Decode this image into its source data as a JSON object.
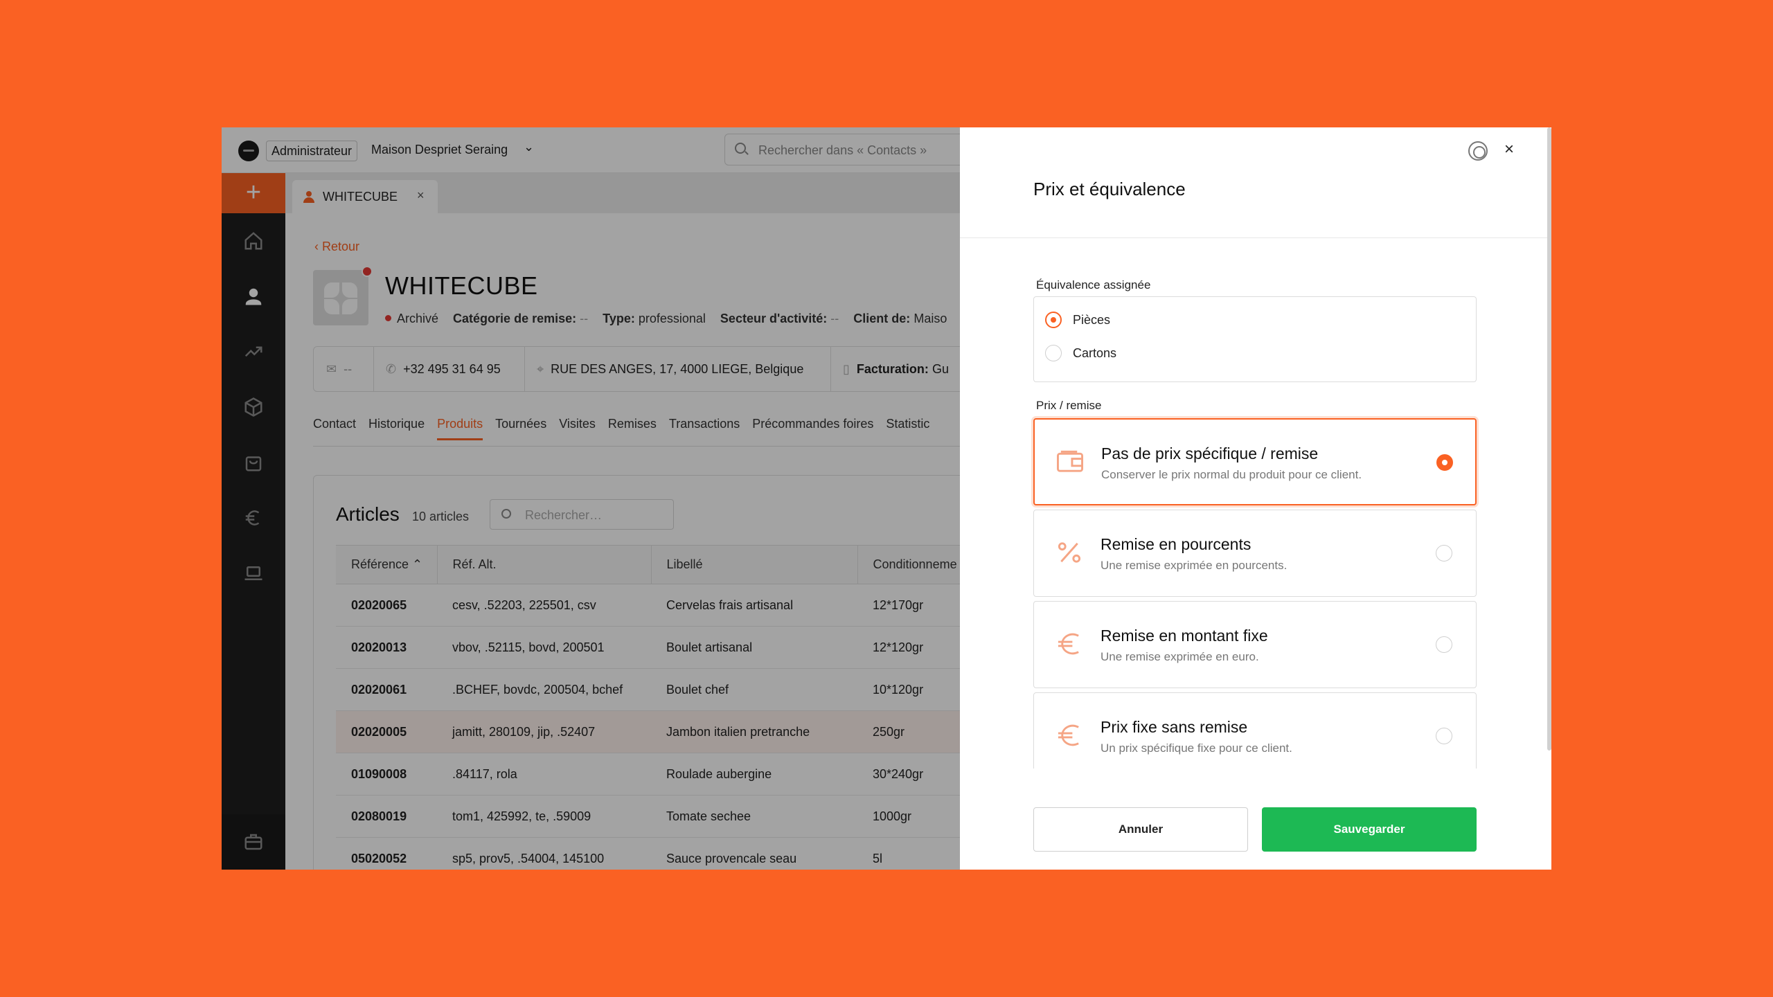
{
  "topbar": {
    "role": "Administrateur",
    "shop": "Maison Despriet Seraing",
    "search_placeholder": "Rechercher dans « Contacts »"
  },
  "tab": {
    "label": "WHITECUBE",
    "close": "×"
  },
  "client": {
    "back": "Retour",
    "name": "WHITECUBE",
    "status": "Archivé",
    "meta": {
      "categorie_label": "Catégorie de remise:",
      "categorie_value": "--",
      "type_label": "Type:",
      "type_value": "professional",
      "secteur_label": "Secteur d'activité:",
      "secteur_value": "--",
      "client_de_label": "Client de:",
      "client_de_value": "Maiso"
    },
    "contact": {
      "email": "--",
      "phone": "+32 495 31 64 95",
      "address": "RUE DES ANGES, 17, 4000 LIEGE, Belgique",
      "billing_label": "Facturation:",
      "billing_value": "Gu"
    },
    "tabs": [
      "Contact",
      "Historique",
      "Produits",
      "Tournées",
      "Visites",
      "Remises",
      "Transactions",
      "Précommandes foires",
      "Statistic"
    ],
    "active_tab": "Produits"
  },
  "articles": {
    "title": "Articles",
    "count": "10 articles",
    "search_placeholder": "Rechercher…",
    "columns": [
      "Référence ⌃",
      "Réf. Alt.",
      "Libellé",
      "Conditionneme"
    ],
    "rows": [
      [
        "02020065",
        "cesv, .52203, 225501, csv",
        "Cervelas frais artisanal",
        "12*170gr"
      ],
      [
        "02020013",
        "vbov, .52115, bovd, 200501",
        "Boulet artisanal",
        "12*120gr"
      ],
      [
        "02020061",
        ".BCHEF, bovdc, 200504, bchef",
        "Boulet chef",
        "10*120gr"
      ],
      [
        "02020005",
        "jamitt, 280109, jip, .52407",
        "Jambon italien pretranche",
        "250gr"
      ],
      [
        "01090008",
        ".84117, rola",
        "Roulade aubergine",
        "30*240gr"
      ],
      [
        "02080019",
        "tom1, 425992, te, .59009",
        "Tomate sechee",
        "1000gr"
      ],
      [
        "05020052",
        "sp5, prov5, .54004, 145100",
        "Sauce provencale seau",
        "5l"
      ]
    ]
  },
  "modal": {
    "title": "Prix et équivalence",
    "equivalence_label": "Équivalence assignée",
    "equivalence_options": [
      "Pièces",
      "Cartons"
    ],
    "price_label": "Prix / remise",
    "options": [
      {
        "title": "Pas de prix spécifique / remise",
        "subtitle": "Conserver le prix normal du produit pour ce client.",
        "icon": "wallet-icon"
      },
      {
        "title": "Remise en pourcents",
        "subtitle": "Une remise exprimée en pourcents.",
        "icon": "percent-icon"
      },
      {
        "title": "Remise en montant fixe",
        "subtitle": "Une remise exprimée en euro.",
        "icon": "euro-icon"
      },
      {
        "title": "Prix fixe sans remise",
        "subtitle": "Un prix spécifique fixe pour ce client.",
        "icon": "euro-icon"
      }
    ],
    "cancel": "Annuler",
    "save": "Sauvegarder",
    "close": "×"
  },
  "colors": {
    "accent": "#FA6123",
    "save": "#1DB954",
    "sidebar": "#1f1f1f"
  }
}
